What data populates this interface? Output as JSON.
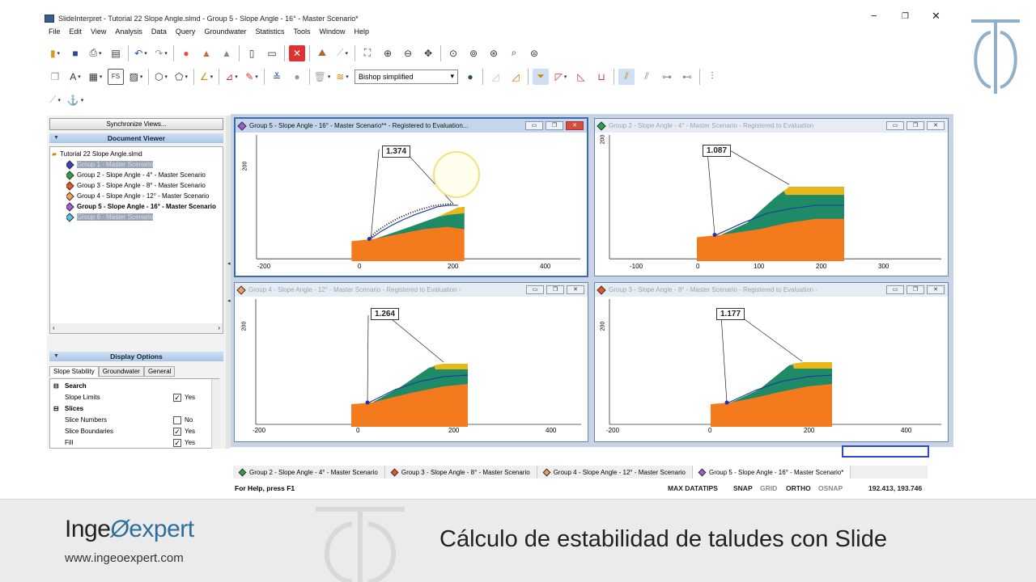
{
  "window": {
    "title": "SlideInterpret - Tutorial 22 Slope Angle.slmd - Group 5 - Slope Angle - 16° - Master Scenario*",
    "minimize": "−",
    "restore": "❐",
    "close": "✕"
  },
  "menu": [
    "File",
    "Edit",
    "View",
    "Analysis",
    "Data",
    "Query",
    "Groundwater",
    "Statistics",
    "Tools",
    "Window",
    "Help"
  ],
  "toolbar": {
    "method": "Bishop simplified"
  },
  "left_panel": {
    "sync_button": "Synchronize Views...",
    "document_viewer": "Document Viewer",
    "file": "Tutorial 22 Slope Angle.slmd",
    "groups": [
      {
        "label": "Group 1 - Master Scenario",
        "color": "#3b3fb8"
      },
      {
        "label": "Group 2 - Slope Angle - 4° - Master Scenario",
        "color": "#2aa14a"
      },
      {
        "label": "Group 3 - Slope Angle - 8° - Master Scenario",
        "color": "#e8552a"
      },
      {
        "label": "Group 4 - Slope Angle - 12° - Master Scenario",
        "color": "#f0a060"
      },
      {
        "label": "Group 5 - Slope Angle - 16° - Master Scenario",
        "color": "#a15bd4"
      },
      {
        "label": "Group 6 - Master Scenario",
        "color": "#4fc8d8"
      }
    ],
    "display_options": "Display Options",
    "tabs": [
      "Slope Stability",
      "Groundwater",
      "General"
    ],
    "props": {
      "search_group": "Search",
      "slope_limits": "Slope Limits",
      "slope_limits_val": "Yes",
      "slices_group": "Slices",
      "slice_numbers": "Slice Numbers",
      "slice_numbers_val": "No",
      "slice_boundaries": "Slice Boundaries",
      "slice_boundaries_val": "Yes",
      "fill": "Fill",
      "fill_val": "Yes"
    },
    "group_toggle": "⊟"
  },
  "views": [
    {
      "title": "Group 5 - Slope Angle - 16° - Master Scenario** - Registered to Evaluation...",
      "fs": "1.374",
      "color": "#a15bd4",
      "ticks": [
        "-200",
        "0",
        "200",
        "400"
      ],
      "ytick": "200"
    },
    {
      "title": "Group 2 - Slope Angle - 4° - Master Scenario - Registered to Evaluation",
      "fs": "1.087",
      "color": "#2aa14a",
      "ticks": [
        "-100",
        "0",
        "100",
        "200",
        "300"
      ],
      "ytick": "200"
    },
    {
      "title": "Group 4 - Slope Angle - 12° - Master Scenario - Registered to Evaluation -",
      "fs": "1.264",
      "color": "#f0a060",
      "ticks": [
        "-200",
        "0",
        "200",
        "400"
      ],
      "ytick": "200"
    },
    {
      "title": "Group 3 - Slope Angle - 8° - Master Scenario - Registered to Evaluation -",
      "fs": "1.177",
      "color": "#e8552a",
      "ticks": [
        "-200",
        "0",
        "200",
        "400"
      ],
      "ytick": "200"
    }
  ],
  "bottom_tabs": [
    {
      "label": "Group 2 - Slope Angle - 4° - Master Scenario",
      "color": "#2aa14a"
    },
    {
      "label": "Group 3 - Slope Angle - 8° - Master Scenario",
      "color": "#e8552a"
    },
    {
      "label": "Group 4 - Slope Angle - 12° - Master Scenario",
      "color": "#f0a060"
    },
    {
      "label": "Group 5 - Slope Angle - 16° - Master Scenario*",
      "color": "#a15bd4"
    }
  ],
  "status": {
    "help": "For Help, press F1",
    "max": "MAX DATATIPS",
    "snap": "SNAP",
    "grid": "GRID",
    "ortho": "ORTHO",
    "osnap": "OSNAP",
    "coords": "192.413,  193.746"
  },
  "footer": {
    "brand_a": "Inge",
    "brand_b": "expert",
    "site": "www.ingeoexpert.com",
    "course": "Cálculo de estabilidad de taludes con Slide"
  }
}
